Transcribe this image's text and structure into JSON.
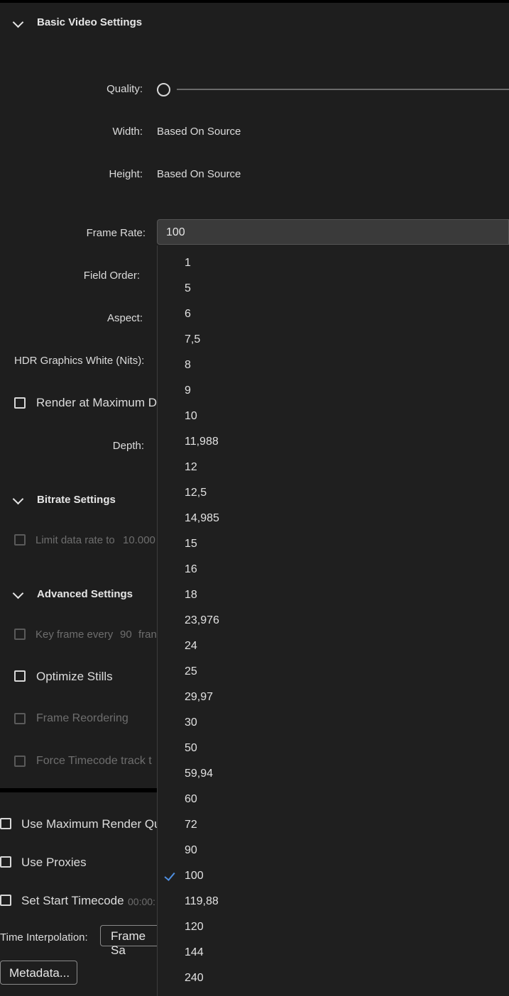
{
  "basic_video": {
    "title": "Basic Video Settings",
    "quality_label": "Quality:",
    "width_label": "Width:",
    "width_value": "Based On Source",
    "height_label": "Height:",
    "height_value": "Based On Source",
    "frame_rate_label": "Frame Rate:",
    "frame_rate_value": "100",
    "field_order_label": "Field Order:",
    "aspect_label": "Aspect:",
    "hdr_label": "HDR Graphics White (Nits):",
    "render_max_depth": "Render at Maximum De",
    "depth_label": "Depth:"
  },
  "bitrate": {
    "title": "Bitrate Settings",
    "limit_label": "Limit data rate to",
    "limit_value": "10.000"
  },
  "advanced": {
    "title": "Advanced Settings",
    "keyframe_label": "Key frame every",
    "keyframe_value": "90",
    "keyframe_suffix": "fran",
    "optimize_stills": "Optimize Stills",
    "frame_reordering": "Frame Reordering",
    "force_timecode": "Force Timecode track t"
  },
  "bottom": {
    "use_max_render": "Use Maximum Render Qu",
    "use_proxies": "Use Proxies",
    "set_start_timecode": "Set Start Timecode",
    "timecode_value": "00:00:",
    "time_interp_label": "Time Interpolation:",
    "time_interp_value": "Frame Sa",
    "metadata_button": "Metadata..."
  },
  "frame_rate_options": [
    "1",
    "5",
    "6",
    "7,5",
    "8",
    "9",
    "10",
    "11,988",
    "12",
    "12,5",
    "14,985",
    "15",
    "16",
    "18",
    "23,976",
    "24",
    "25",
    "29,97",
    "30",
    "50",
    "59,94",
    "60",
    "72",
    "90",
    "100",
    "119,88",
    "120",
    "144",
    "240"
  ],
  "selected_option_index": 24,
  "quality_level": 0,
  "accent_color": "#4f8fe0"
}
